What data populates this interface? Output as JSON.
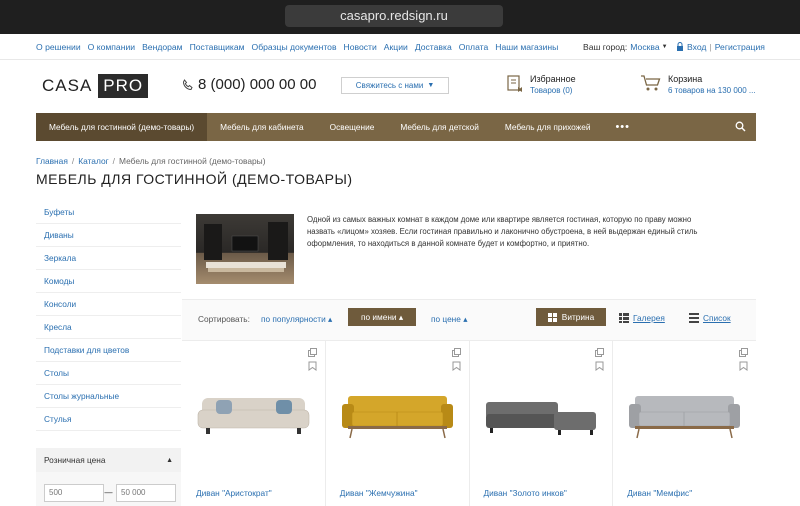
{
  "browser": {
    "url": "casapro.redsign.ru"
  },
  "toplinks": [
    "О решении",
    "О компании",
    "Вендорам",
    "Поставщикам",
    "Образцы документов",
    "Новости",
    "Акции",
    "Доставка",
    "Оплата",
    "Наши магазины"
  ],
  "city": {
    "label": "Ваш город:",
    "value": "Москва"
  },
  "auth": {
    "login": "Вход",
    "register": "Регистрация"
  },
  "logo": {
    "part1": "CASA",
    "part2": "PRO"
  },
  "phone": "8 (000) 000 00 00",
  "contact_button": "Свяжитесь с нами",
  "favorites": {
    "title": "Избранное",
    "sub": "Товаров (0)"
  },
  "cart": {
    "title": "Корзина",
    "sub": "6 товаров на 130 000 ..."
  },
  "nav": [
    {
      "label": "Мебель для гостинной (демо-товары)",
      "active": true
    },
    {
      "label": "Мебель для кабинета",
      "active": false
    },
    {
      "label": "Освещение",
      "active": false
    },
    {
      "label": "Мебель для детской",
      "active": false
    },
    {
      "label": "Мебель для прихожей",
      "active": false
    }
  ],
  "nav_more": "•••",
  "breadcrumb": [
    "Главная",
    "Каталог",
    "Мебель для гостинной (демо-товары)"
  ],
  "page_title": "МЕБЕЛЬ ДЛЯ ГОСТИННОЙ (ДЕМО-ТОВАРЫ)",
  "sidebar": [
    "Буфеты",
    "Диваны",
    "Зеркала",
    "Комоды",
    "Консоли",
    "Кресла",
    "Подставки для цветов",
    "Столы",
    "Столы журнальные",
    "Стулья"
  ],
  "filter": {
    "title": "Розничная цена",
    "min": "500",
    "max": "50 000"
  },
  "intro": "Одной из самых важных комнат в каждом доме или квартире является гостиная, которую по праву можно назвать «лицом» хозяев. Если гостиная правильно и лаконично обустроена, в ней выдержан единый стиль оформления, то находиться в данной комнате будет и комфортно, и приятно.",
  "sort": {
    "label": "Сортировать:",
    "popularity": "по популярности",
    "name": "по имени",
    "price": "по цене"
  },
  "views": {
    "showcase": "Витрина",
    "gallery": "Галерея",
    "list": "Список"
  },
  "products": [
    {
      "name": "Диван \"Аристократ\"",
      "color": "#d9d2c8",
      "accent": "#6f8fa8"
    },
    {
      "name": "Диван \"Жемчужина\"",
      "color": "#d4a62a",
      "accent": "#b88a16"
    },
    {
      "name": "Диван \"Золото инков\"",
      "color": "#6d6d6d",
      "accent": "#555555"
    },
    {
      "name": "Диван \"Мемфис\"",
      "color": "#b7b9bd",
      "accent": "#9ea0a4"
    }
  ]
}
